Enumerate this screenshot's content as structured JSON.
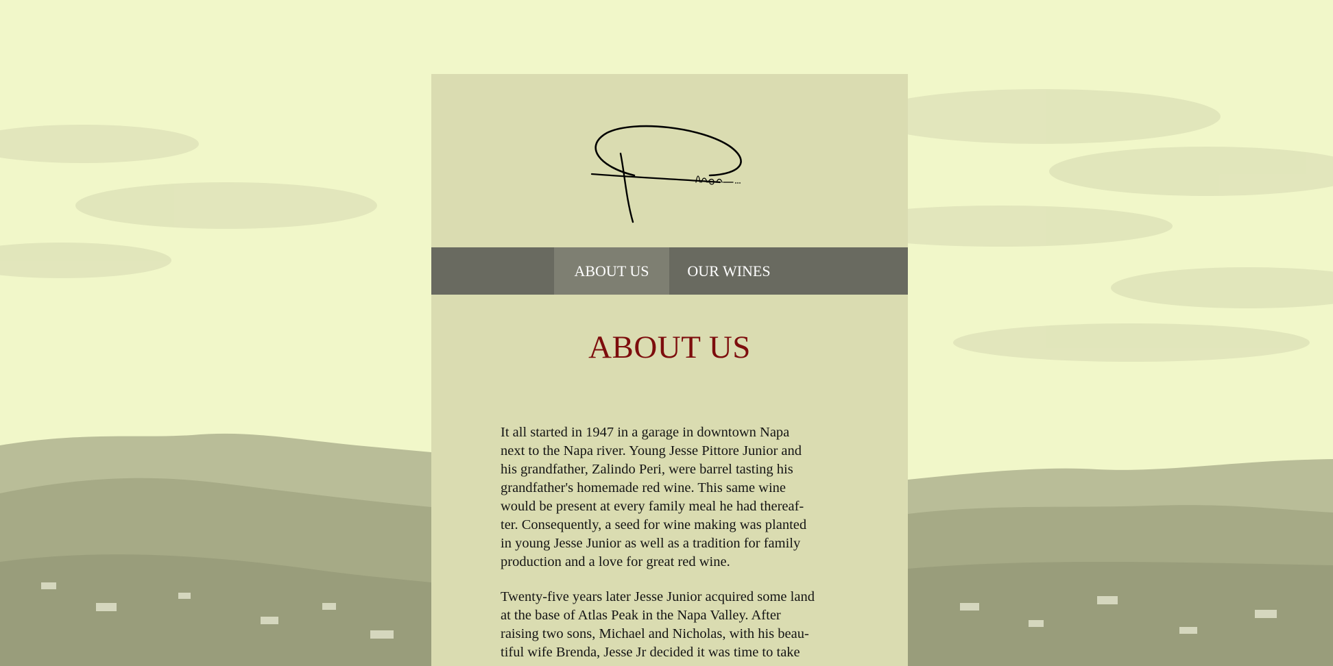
{
  "brand": {
    "logo_icon": "pittore-signature-logo",
    "logo_text": "Pittore"
  },
  "nav": {
    "items": [
      {
        "label": "ABOUT US",
        "active": true
      },
      {
        "label": "OUR WINES",
        "active": false
      }
    ]
  },
  "main": {
    "title": "ABOUT US",
    "paragraphs": [
      "It all started in 1947 in a garage in downtown Napa\nnext to the Napa river. Young Jesse Pittore Junior and\nhis grandfather, Zalindo Peri, were barrel tasting his\ngrandfather's homemade red wine.  This same wine\nwould be present at every family meal he had thereaf-\nter. Consequently, a seed for wine making was planted\nin young Jesse Junior as well as a tradition for family\nproduction and a love for great red wine.",
      "Twenty-five years later Jesse Junior acquired some land\nat the base of Atlas Peak in the Napa Valley. After\nraising two sons, Michael and Nicholas, with his beau-\ntiful wife Brenda, Jesse Jr decided it was time to take"
    ]
  },
  "colors": {
    "background": "#f1f7c9",
    "card": "#dadcb1",
    "nav_bar": "#696a60",
    "nav_active": "#7e7f72",
    "title": "#7d0d0d",
    "text": "#141414"
  }
}
